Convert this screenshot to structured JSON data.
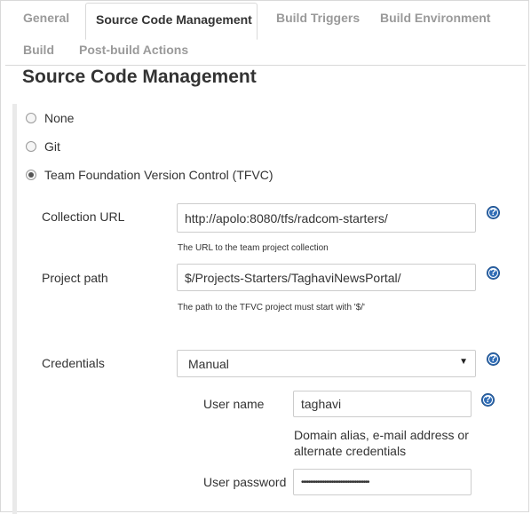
{
  "tabs": [
    {
      "label": "General",
      "active": false
    },
    {
      "label": "Source Code Management",
      "active": true
    },
    {
      "label": "Build Triggers",
      "active": false
    },
    {
      "label": "Build Environment",
      "active": false
    },
    {
      "label": "Build",
      "active": false
    },
    {
      "label": "Post-build Actions",
      "active": false
    }
  ],
  "section_title": "Source Code Management",
  "scm_options": [
    {
      "label": "None",
      "selected": false
    },
    {
      "label": "Git",
      "selected": false
    },
    {
      "label": "Team Foundation Version Control (TFVC)",
      "selected": true
    }
  ],
  "form": {
    "collection_url": {
      "label": "Collection URL",
      "value": "http://apolo:8080/tfs/radcom-starters/",
      "hint": "The URL to the team project collection"
    },
    "project_path": {
      "label": "Project path",
      "value": "$/Projects-Starters/TaghaviNewsPortal/",
      "hint": "The path to the TFVC project must start with '$/'"
    },
    "credentials": {
      "label": "Credentials",
      "selected": "Manual"
    },
    "user_name": {
      "label": "User name",
      "value": "taghavi",
      "description_line1": "Domain alias, e-mail address or",
      "description_line2": "alternate credentials"
    },
    "user_password": {
      "label": "User password",
      "masked_value": "••••••••••••••••••••••••••••••••••••••"
    }
  },
  "icons": {
    "help": "help-question-icon",
    "caret": "chevron-down-icon"
  },
  "colors": {
    "help_blue": "#2f6cb5",
    "tab_inactive": "#9a9a9a",
    "border": "#d9d9d9"
  }
}
